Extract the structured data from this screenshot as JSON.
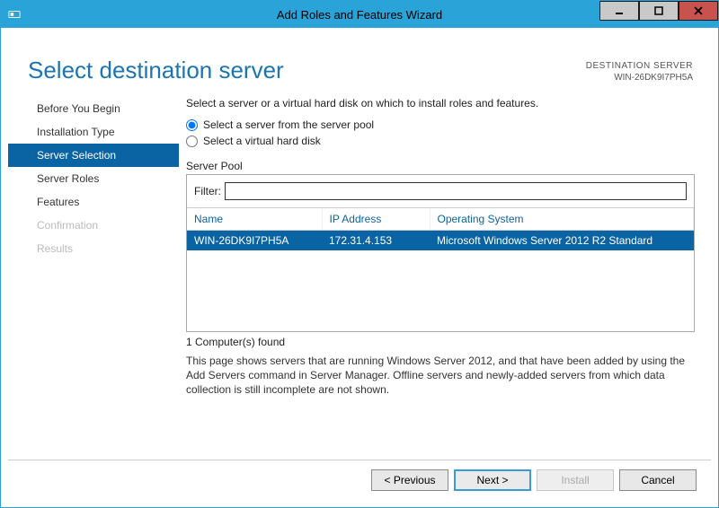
{
  "window": {
    "title": "Add Roles and Features Wizard"
  },
  "header": {
    "page_title": "Select destination server",
    "dest_label": "DESTINATION SERVER",
    "dest_value": "WIN-26DK9I7PH5A"
  },
  "steps": {
    "items": [
      {
        "label": "Before You Begin",
        "state": "normal"
      },
      {
        "label": "Installation Type",
        "state": "normal"
      },
      {
        "label": "Server Selection",
        "state": "active"
      },
      {
        "label": "Server Roles",
        "state": "normal"
      },
      {
        "label": "Features",
        "state": "normal"
      },
      {
        "label": "Confirmation",
        "state": "disabled"
      },
      {
        "label": "Results",
        "state": "disabled"
      }
    ]
  },
  "main": {
    "instruction": "Select a server or a virtual hard disk on which to install roles and features.",
    "radio_pool": "Select a server from the server pool",
    "radio_vhd": "Select a virtual hard disk",
    "pool_title": "Server Pool",
    "filter_label": "Filter:",
    "filter_value": "",
    "columns": {
      "name": "Name",
      "ip": "IP Address",
      "os": "Operating System"
    },
    "servers": [
      {
        "name": "WIN-26DK9I7PH5A",
        "ip": "172.31.4.153",
        "os": "Microsoft Windows Server 2012 R2 Standard"
      }
    ],
    "count_label": "1 Computer(s) found",
    "hint": "This page shows servers that are running Windows Server 2012, and that have been added by using the Add Servers command in Server Manager. Offline servers and newly-added servers from which data collection is still incomplete are not shown."
  },
  "footer": {
    "previous": "< Previous",
    "next": "Next >",
    "install": "Install",
    "cancel": "Cancel"
  }
}
